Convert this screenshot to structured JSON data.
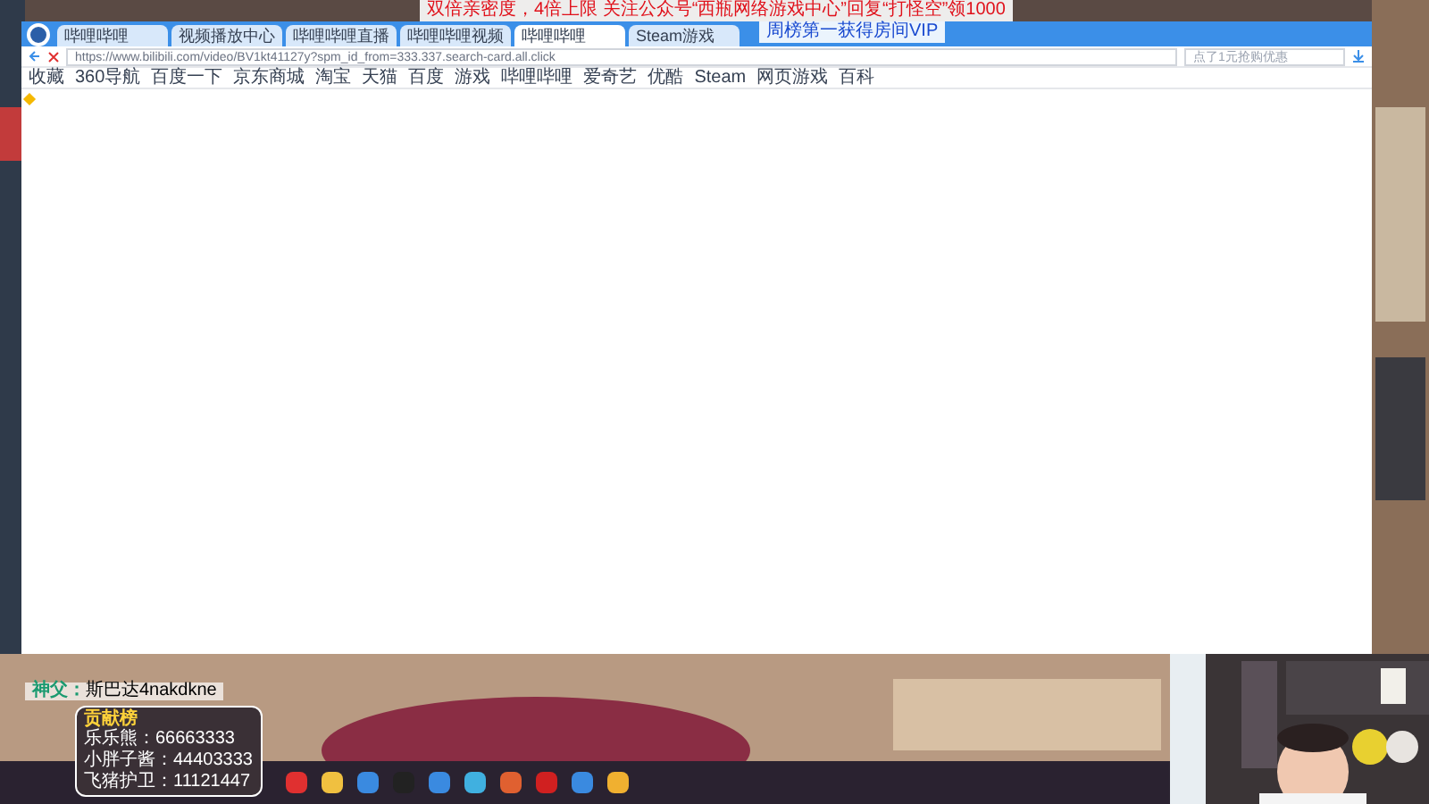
{
  "overlay_lines": [
    "双倍亲密度，4倍上限 关注公众号“西瓶网络游戏中心”回复“打怪空”领1000",
    "周榜第一获得房间VIP"
  ],
  "browser": {
    "tabs": [
      {
        "title": "哔哩哔哩",
        "selected": false
      },
      {
        "title": "视频播放中心",
        "selected": false
      },
      {
        "title": "哔哩哔哩直播",
        "selected": false
      },
      {
        "title": "哔哩哔哩视频",
        "selected": false
      },
      {
        "title": "哔哩哔哩",
        "selected": true
      },
      {
        "title": "Steam游戏",
        "selected": false
      }
    ],
    "address": "https://www.bilibili.com/video/BV1kt41127y?spm_id_from=333.337.search-card.all.click",
    "search_placeholder": "点了1元抢购优惠",
    "bookmarks": [
      "收藏",
      "360导航",
      "百度一下",
      "京东商城",
      "淘宝",
      "天猫",
      "百度",
      "游戏",
      "哔哩哔哩",
      "爱奇艺",
      "优酷",
      "Steam",
      "网页游戏",
      "百科"
    ]
  },
  "chat": {
    "user": "神父：",
    "message": "斯巴达4nakdkne"
  },
  "ranking": {
    "title": "贡献榜",
    "entries": [
      "乐乐熊：66663333",
      "小胖子酱：44403333",
      "飞猪护卫：11121447"
    ]
  }
}
